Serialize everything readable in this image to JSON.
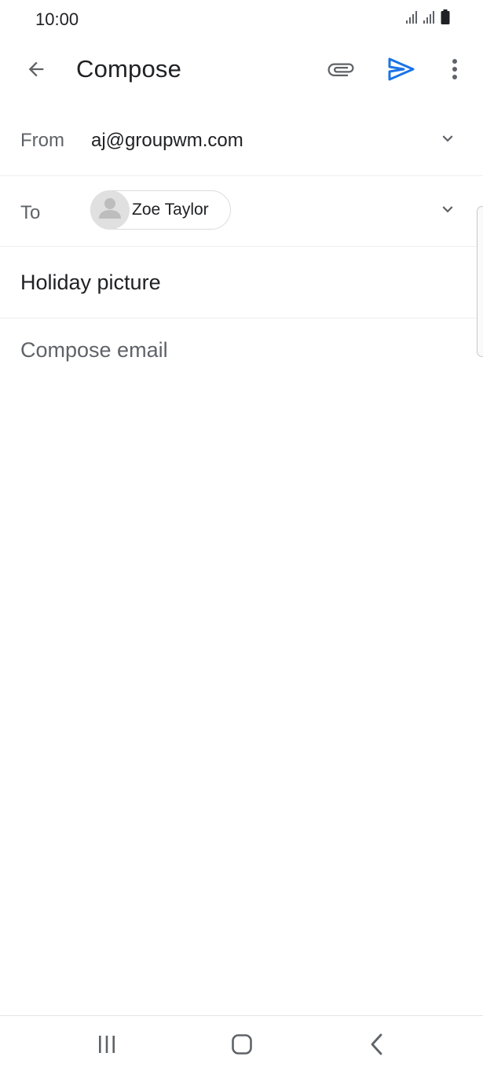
{
  "status_bar": {
    "time": "10:00",
    "icons": [
      "signal-icon",
      "signal-icon",
      "battery-icon"
    ]
  },
  "app_bar": {
    "title": "Compose",
    "icons": [
      "back-arrow-icon",
      "attach-icon",
      "send-icon",
      "more-vert-icon"
    ],
    "send_color": "#1a73e8"
  },
  "compose": {
    "from_label": "From",
    "from_value": "aj@groupwm.com",
    "to_label": "To",
    "recipient": {
      "name": "Zoe Taylor"
    },
    "subject": "Holiday picture",
    "body_placeholder": "Compose email"
  },
  "nav_bar": {
    "icons": [
      "recents-icon",
      "home-icon",
      "nav-back-icon"
    ]
  }
}
